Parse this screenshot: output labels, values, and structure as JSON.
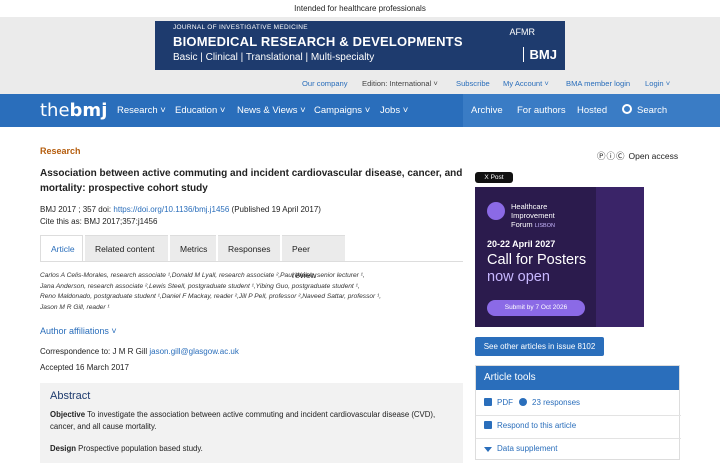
{
  "top_note": "Intended for healthcare professionals",
  "banner": {
    "journal": "JOURNAL OF INVESTIGATIVE MEDICINE",
    "headline": "BIOMEDICAL RESEARCH & DEVELOPMENTS",
    "subline": "Basic  |  Clinical  |  Translational  |  Multi-specialty",
    "afmr": "AFMR",
    "bmj": "BMJ"
  },
  "utility_nav": {
    "our_company": "Our company",
    "edition": "Edition: International ˅",
    "subscribe": "Subscribe",
    "my_account": "My Account ˅",
    "bma_login": "BMA member login",
    "login": "Login ˅"
  },
  "main_nav": {
    "logo_prefix": "the",
    "logo_main": "bmj",
    "items": [
      "Research ˅",
      "Education ˅",
      "News & Views ˅",
      "Campaigns ˅",
      "Jobs ˅"
    ],
    "archive": "Archive",
    "for_authors": "For authors",
    "hosted": "Hosted",
    "search": "Search"
  },
  "article": {
    "section": "Research",
    "open_access": "Open access",
    "title": "Association between active commuting and incident cardiovascular disease, cancer, and mortality: prospective cohort study",
    "citation_line": "BMJ 2017 ; 357  doi:",
    "doi": "https://doi.org/10.1136/bmj.j1456",
    "published": " (Published 19 April 2017)",
    "cite_as": "Cite this as: BMJ 2017;357:j1456",
    "tabs": [
      "Article",
      "Related content",
      "Metrics",
      "Responses",
      "Peer review"
    ],
    "authors": [
      "Carlos A Celis-Morales, research associate ¹,Donald M Lyall, research associate ²,Paul Welsh, senior lecturer ¹,",
      "Jana Anderson, research associate ²,Lewis Steell, postgraduate student ¹,Yibing Guo, postgraduate student ¹,",
      "Reno Maldonado, postgraduate student ¹,Daniel F Mackay, reader ²,Jill P Pell, professor ²,Naveed Sattar, professor ¹,",
      "Jason M R Gill, reader ¹"
    ],
    "author_affiliations": "Author affiliations ˅",
    "correspondence_label": "Correspondence to: J M R Gill ",
    "correspondence_email": "jason.gill@glasgow.ac.uk",
    "accepted": "Accepted 16 March 2017",
    "abstract_heading": "Abstract",
    "objective_label": "Objective",
    "objective_text": " To investigate the association between active commuting and incident cardiovascular disease (CVD), cancer, and all cause mortality.",
    "design_label": "Design",
    "design_text": " Prospective population based study."
  },
  "sidebar": {
    "x_post": "X Post",
    "ad": {
      "org_line1": "Healthcare",
      "org_line2": "Improvement",
      "org_line3": "Forum",
      "org_city": "LISBON",
      "date": "20-22 April 2027",
      "cfp_line1": "Call for Posters",
      "cfp_line2": "now open",
      "submit": "Submit by 7 Oct 2026"
    },
    "issue_button": "See other articles in issue 8102",
    "tools": {
      "heading": "Article tools",
      "pdf": "PDF",
      "responses": "23 responses",
      "respond": "Respond to this article",
      "data_supplement": "Data supplement"
    }
  }
}
